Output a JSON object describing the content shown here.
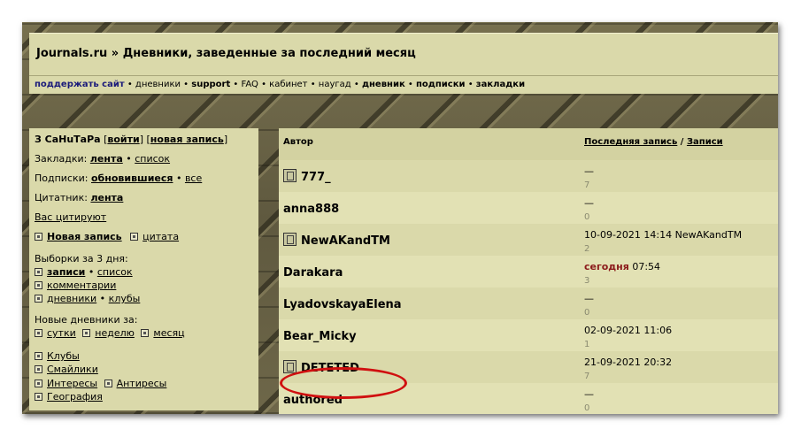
{
  "header": {
    "title": "Journals.ru » Дневники, заведенные за последний месяц"
  },
  "nav": {
    "items": [
      {
        "label": "поддержать сайт",
        "style": "blue"
      },
      {
        "label": "дневники",
        "style": "plain"
      },
      {
        "label": "support",
        "style": "b"
      },
      {
        "label": "FAQ",
        "style": "plain"
      },
      {
        "label": "кабинет",
        "style": "plain"
      },
      {
        "label": "наугад",
        "style": "plain"
      },
      {
        "label": "дневник",
        "style": "b"
      },
      {
        "label": "подписки",
        "style": "b"
      },
      {
        "label": "закладки",
        "style": "b"
      }
    ],
    "separator": " • "
  },
  "sidebar": {
    "user": "З СаНuТаРа",
    "login": "войти",
    "new_post_bracket": "новая запись",
    "bookmarks_label": "Закладки:",
    "bookmarks_feed": "лента",
    "bookmarks_list": "список",
    "subs_label": "Подписки:",
    "subs_updated": "обновившиеся",
    "subs_all": "все",
    "quotes_label": "Цитатник:",
    "quotes_feed": "лента",
    "quoted_you": "Вас цитируют",
    "new_post": "Новая запись",
    "quote": "цитата",
    "samples_label": "Выборки за 3 дня:",
    "samples_posts": "записи",
    "samples_list": "список",
    "samples_comments": "комментарии",
    "samples_diaries": "дневники",
    "samples_clubs": "клубы",
    "new_diaries_label": "Новые дневники за:",
    "nd_day": "сутки",
    "nd_week": "неделю",
    "nd_month": "месяц",
    "clubs": "Клубы",
    "smileys": "Смайлики",
    "interests": "Интересы",
    "anti_interests": "Антиресы",
    "geography": "География"
  },
  "table": {
    "col_author": "Автор",
    "col_last": "Последняя запись",
    "col_sep": " / ",
    "col_posts": "Записи",
    "rows": [
      {
        "author": "777_",
        "icon": "diary-icon",
        "last": "—",
        "count": "7"
      },
      {
        "author": "anna888",
        "icon": "",
        "last": "—",
        "count": "0"
      },
      {
        "author": "NewAKandTM",
        "icon": "community-icon",
        "last": "10-09-2021 14:14 NewAKandTM",
        "count": "2"
      },
      {
        "author": "Darakara",
        "icon": "",
        "last_today": "сегодня",
        "last": " 07:54",
        "count": "3"
      },
      {
        "author": "LyadovskayaElena",
        "icon": "",
        "last": "—",
        "count": "0"
      },
      {
        "author": "Bear_Micky",
        "icon": "",
        "last": "02-09-2021 11:06",
        "count": "1"
      },
      {
        "author": "DETETED",
        "icon": "user-icon",
        "last": "21-09-2021 20:32",
        "count": "7"
      },
      {
        "author": "authored",
        "icon": "",
        "last": "—",
        "count": "0"
      }
    ]
  }
}
